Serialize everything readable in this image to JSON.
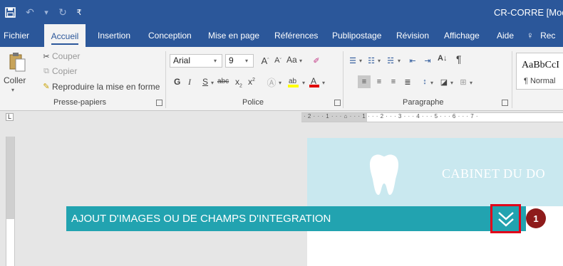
{
  "titlebar": {
    "save_icon": "save-icon",
    "undo_icon": "undo-icon",
    "redo_icon": "redo-icon",
    "qat_dropdown_icon": "chevron-down-icon",
    "document_title": "CR-CORRE [Mode c"
  },
  "tabs": [
    {
      "label": "Fichier"
    },
    {
      "label": "Accueil",
      "active": true
    },
    {
      "label": "Insertion"
    },
    {
      "label": "Conception"
    },
    {
      "label": "Mise en page"
    },
    {
      "label": "Références"
    },
    {
      "label": "Publipostage"
    },
    {
      "label": "Révision"
    },
    {
      "label": "Affichage"
    },
    {
      "label": "Aide"
    },
    {
      "label": "Rec"
    }
  ],
  "ribbon": {
    "clipboard": {
      "paste_label": "Coller",
      "cut_label": "Couper",
      "copy_label": "Copier",
      "format_painter_label": "Reproduire la mise en forme",
      "group_label": "Presse-papiers"
    },
    "font": {
      "font_name": "Arial",
      "font_size": "9",
      "change_case_label": "Aa",
      "bold": "G",
      "italic": "I",
      "underline": "S",
      "strike": "abc",
      "subscript": "x",
      "superscript": "x",
      "group_label": "Police"
    },
    "paragraph": {
      "group_label": "Paragraphe",
      "sort_label": "A↓",
      "pilcrow": "¶"
    },
    "styles": {
      "preview": "AaBbCcI",
      "normal_label": "¶ Normal"
    }
  },
  "ruler": {
    "corner": "L",
    "ticks": "· 2 · · · 1 · · · ⌂ · · · 1 · · · 2 · · · 3 · · · 4 · · · 5 · · · 6 · · · 7 ·"
  },
  "document": {
    "header_text": "CABINET DU DO"
  },
  "banner": {
    "title": "AJOUT D'IMAGES OU DE CHAMPS D'INTEGRATION",
    "expand_icon": "double-chevron-down-icon",
    "step_number": "1"
  },
  "colors": {
    "word_blue": "#2b579a",
    "banner_teal": "#22a3b0",
    "highlight_red": "#e2001a",
    "badge_red": "#8e1b1b",
    "header_light_blue": "#c9e8ef"
  }
}
